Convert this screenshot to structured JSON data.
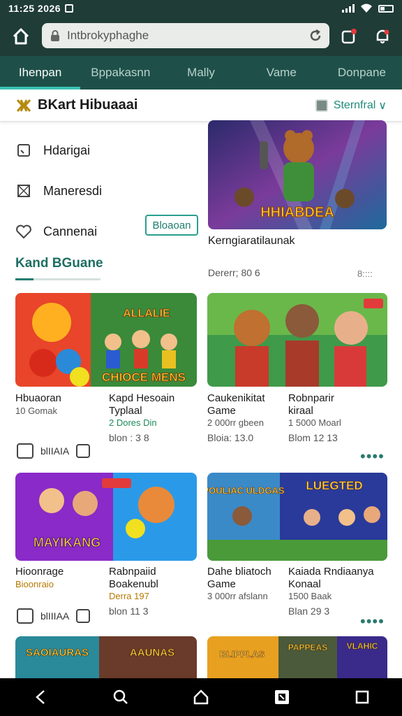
{
  "status": {
    "time": "11:25 2026"
  },
  "browser": {
    "url": "Intbrokyphaghe"
  },
  "tabs": [
    {
      "label": "Ihenpan"
    },
    {
      "label": "Bppakasnn"
    },
    {
      "label": "Mally"
    },
    {
      "label": "Vame"
    },
    {
      "label": "Donpane"
    }
  ],
  "header": {
    "title": "BKart Hibuaaai",
    "selector": "Sternfral"
  },
  "menu": {
    "items": [
      {
        "label": "Hdarigai"
      },
      {
        "label": "Maneresdi"
      },
      {
        "label": "Cannenai"
      }
    ],
    "button": "Bloaoan",
    "section": "Kand BGuane"
  },
  "featured": {
    "art_text": "HHIABDEA",
    "title": "Kerngiaratilaunak",
    "sub": "Dererr; 80 6",
    "count": "8::::"
  },
  "cards": [
    {
      "title": "Hbuaoran",
      "sub": "10 Gomak",
      "meta": "",
      "stat": ""
    },
    {
      "art_text": "CHIOCE MENS",
      "title": "Kapd Hesoain",
      "sub": "Typlaal",
      "meta": "2 Dores Din",
      "stat": "blon : 3 8"
    },
    {
      "title": "Caukenikitat",
      "sub": "Game",
      "meta": "2 000rr gbeen",
      "stat": "Bloia: 13.0"
    },
    {
      "title": "Robnparir",
      "sub": "kiraal",
      "meta": "1 5000 Moarl",
      "stat": "Blom 12 13"
    },
    {
      "art_text": "MAYIKANG",
      "title": "Hioonrage",
      "sub": "Bioonraio",
      "meta": "",
      "stat": ""
    },
    {
      "title": "Rabnpaiid",
      "sub": "Boakenubl",
      "meta": "Derra 197",
      "stat": "blon 11 3"
    },
    {
      "art_text": "POULIAC ULDGAS",
      "title": "Dahe bliatoch",
      "sub": "Game",
      "meta": "3 000rr afslann",
      "stat": ""
    },
    {
      "art_text": "LUEGTED",
      "title": "Kaiada Rndiaanya",
      "sub": "Konaal",
      "meta": "1500 Baak",
      "stat": "Blan 29 3"
    }
  ],
  "row_actions": [
    "blIIAIA",
    "blIIIAA"
  ],
  "bottom_art": [
    "SAOIAURAS",
    "AAUNAS",
    "BLIPPLAS",
    "PAPPEAS",
    "VLAHIC"
  ],
  "colors": {
    "bar": "#1f3c37",
    "tabs": "#1e5049",
    "accent": "#3ac3b1",
    "teal": "#1e7e6f"
  }
}
